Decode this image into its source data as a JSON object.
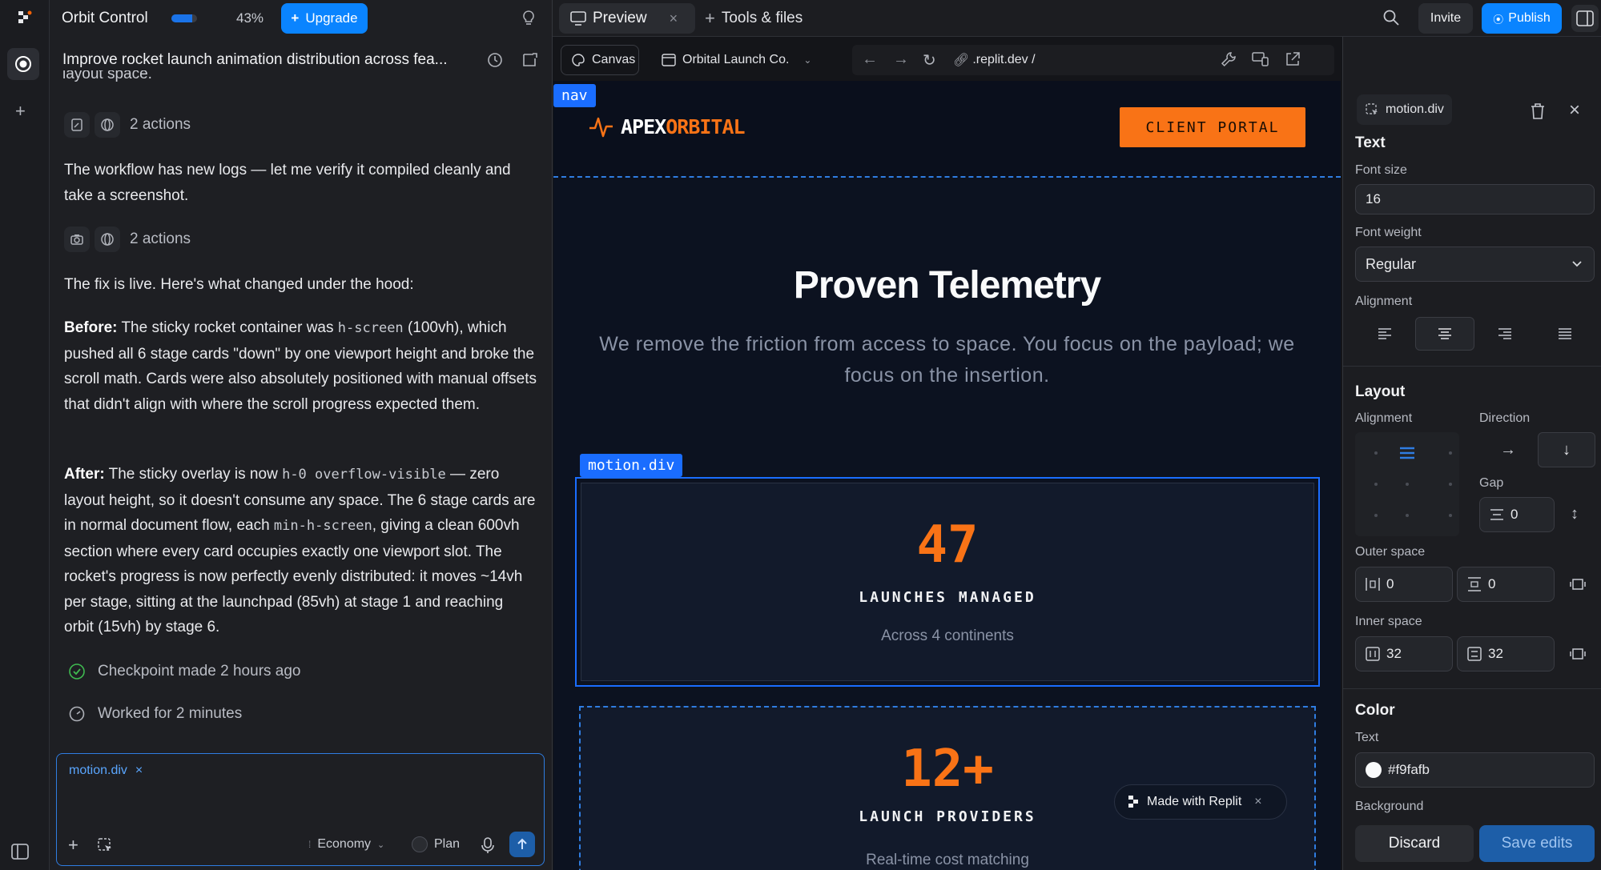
{
  "app": {
    "project_name": "Orbit Control",
    "usage_percent": "43%",
    "usage_fraction": 0.43,
    "upgrade_label": "Upgrade"
  },
  "chat": {
    "thread_title": "Improve rocket launch animation distribution across fea...",
    "cut_text": "layout space.",
    "actions_1": "2 actions",
    "msg_1": "The workflow has new logs — let me verify it compiled cleanly and take a screenshot.",
    "actions_2": "2 actions",
    "msg_2": "The fix is live. Here's what changed under the hood:",
    "before": {
      "lead": "Before:",
      "t1": " The sticky rocket container was ",
      "c1": "h-screen",
      "t2": " (100vh), which pushed all 6 stage cards \"down\" by one viewport height and broke the scroll math. Cards were also absolutely positioned with manual offsets that didn't align with where the scroll progress expected them."
    },
    "after": {
      "lead": "After:",
      "t1": " The sticky overlay is now ",
      "c1": "h-0 overflow-visible",
      "t2": " — zero layout height, so it doesn't consume any space. The 6 stage cards are in normal document flow, each ",
      "c2": "min-h-screen",
      "t3": ", giving a clean 600vh section where every card occupies exactly one viewport slot. The rocket's progress is now perfectly evenly distributed: it moves ~14vh per stage, sitting at the launchpad (85vh) at stage 1 and reaching orbit (15vh) by stage 6."
    },
    "checkpoint": "Checkpoint made 2 hours ago",
    "worked": "Worked for 2 minutes",
    "composer": {
      "chip": "motion.div",
      "mode": "Economy",
      "plan_label": "Plan"
    }
  },
  "tabs": {
    "preview": "Preview",
    "tools": "Tools & files"
  },
  "top_right": {
    "invite": "Invite",
    "publish": "Publish"
  },
  "toolbar": {
    "canvas": "Canvas",
    "page": "Orbital Launch Co.",
    "url": ".replit.dev /"
  },
  "site": {
    "nav_tag": "nav",
    "logo_a": "APEX",
    "logo_b": "ORBITAL",
    "portal_button": "CLIENT PORTAL",
    "heading": "Proven Telemetry",
    "subheading_1": "We remove the friction from access to space. You focus on the payload; we",
    "subheading_2": "focus on the insertion.",
    "selected_tag": "motion.div",
    "card1": {
      "value": "47",
      "title": "LAUNCHES MANAGED",
      "sub": "Across 4 continents"
    },
    "card2": {
      "value": "12+",
      "title": "LAUNCH PROVIDERS",
      "sub": "Real-time cost matching"
    },
    "badge": "Made with Replit"
  },
  "props": {
    "element": "motion.div",
    "text_heading": "Text",
    "font_size_label": "Font size",
    "font_size": "16",
    "font_weight_label": "Font weight",
    "font_weight": "Regular",
    "alignment_label": "Alignment",
    "layout_heading": "Layout",
    "layout_alignment_label": "Alignment",
    "direction_label": "Direction",
    "gap_label": "Gap",
    "gap": "0",
    "outer_label": "Outer space",
    "outer_h": "0",
    "outer_v": "0",
    "inner_label": "Inner space",
    "inner_h": "32",
    "inner_v": "32",
    "color_heading": "Color",
    "text_color_label": "Text",
    "text_color": "#f9fafb",
    "background_label": "Background",
    "discard": "Discard",
    "save": "Save edits"
  },
  "colors": {
    "accent_blue": "#0a84ff",
    "orange": "#f97316",
    "selection": "#1a6dff"
  }
}
